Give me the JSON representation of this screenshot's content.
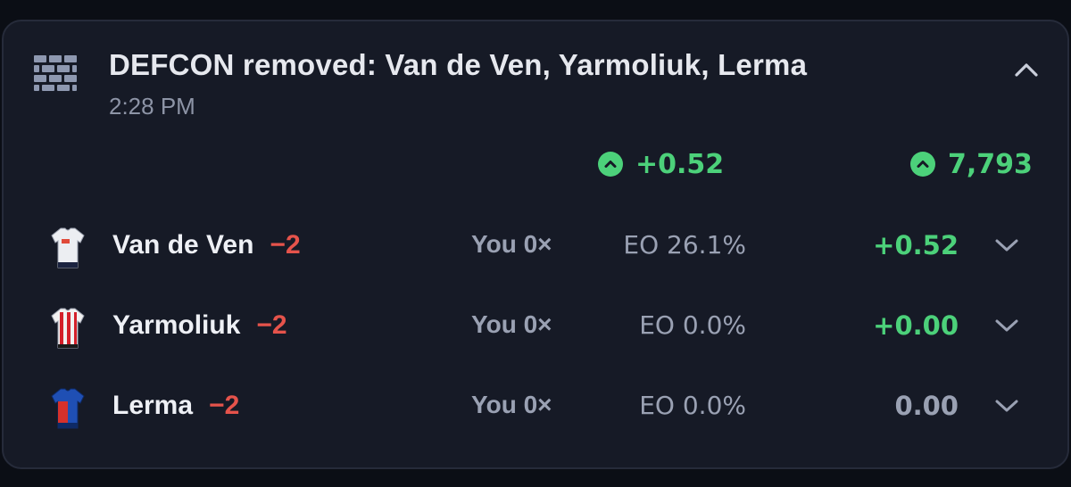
{
  "event": {
    "icon": "brick-wall-icon",
    "title": "DEFCON removed: Van de Ven, Yarmoliuk, Lerma",
    "time": "2:28 PM",
    "collapse_icon": "chevron-up-icon"
  },
  "summary": {
    "points_change": "+0.52",
    "rank_change": "7,793",
    "up_icon": "arrow-up-circle-icon",
    "color": "#4cd17a"
  },
  "players": [
    {
      "name": "Van de Ven",
      "delta": "−2",
      "you": "You 0×",
      "eo": "EO 26.1%",
      "points": "+0.52",
      "kit": "tottenham-shirt-icon"
    },
    {
      "name": "Yarmoliuk",
      "delta": "−2",
      "you": "You 0×",
      "eo": "EO 0.0%",
      "points": "+0.00",
      "kit": "brentford-shirt-icon"
    },
    {
      "name": "Lerma",
      "delta": "−2",
      "you": "You 0×",
      "eo": "EO 0.0%",
      "points": "0.00",
      "kit": "crystal-palace-shirt-icon"
    }
  ],
  "colors": {
    "positive": "#4cd17a",
    "negative": "#e5534b",
    "card_bg": "#161a26",
    "page_bg": "#0b0e15"
  }
}
